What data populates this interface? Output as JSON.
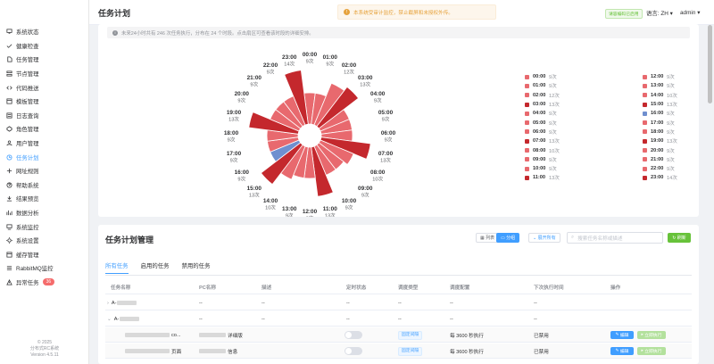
{
  "sidebar": {
    "items": [
      {
        "label": "系统状态",
        "icon": "monitor-icon"
      },
      {
        "label": "健康检查",
        "icon": "check-icon"
      },
      {
        "label": "任务管理",
        "icon": "file-icon"
      },
      {
        "label": "节点管理",
        "icon": "node-icon"
      },
      {
        "label": "代码推送",
        "icon": "code-icon"
      },
      {
        "label": "模板管理",
        "icon": "template-icon"
      },
      {
        "label": "日志查询",
        "icon": "log-icon"
      },
      {
        "label": "角色管理",
        "icon": "role-icon"
      },
      {
        "label": "用户管理",
        "icon": "user-icon"
      },
      {
        "label": "任务计划",
        "icon": "clock-icon",
        "active": true
      },
      {
        "label": "网址规则",
        "icon": "link-icon"
      },
      {
        "label": "帮助系统",
        "icon": "help-icon"
      },
      {
        "label": "结果预览",
        "icon": "download-icon"
      },
      {
        "label": "数据分析",
        "icon": "chart-icon"
      },
      {
        "label": "系统监控",
        "icon": "screen-icon"
      },
      {
        "label": "系统设置",
        "icon": "gear-icon"
      },
      {
        "label": "缓存管理",
        "icon": "cache-icon"
      },
      {
        "label": "RabbitMQ监控",
        "icon": "queue-icon"
      },
      {
        "label": "异常任务",
        "icon": "warning-icon",
        "badge": "36"
      }
    ],
    "footer_line1": "© 2025",
    "footer_line2": "分布式RC系统",
    "footer_line3": "Version 4.5.11"
  },
  "header": {
    "title": "任务计划",
    "warning": "本系统受审计监控，禁止截屏和未授权外传。",
    "tag": "请容编码已启用",
    "lang": "语言: ZH",
    "user": "admin"
  },
  "overview": {
    "info": "未来24小时共有 246 次任务执行，分布在 24 个时段。点击扇区可查看该时段的详细安排。"
  },
  "chart_data": {
    "type": "pie",
    "subtype": "rose",
    "categories": [
      "00:00",
      "01:00",
      "02:00",
      "03:00",
      "04:00",
      "05:00",
      "06:00",
      "07:00",
      "08:00",
      "09:00",
      "10:00",
      "11:00",
      "12:00",
      "13:00",
      "14:00",
      "15:00",
      "16:00",
      "17:00",
      "18:00",
      "19:00",
      "20:00",
      "21:00",
      "22:00",
      "23:00"
    ],
    "values": [
      9,
      9,
      12,
      13,
      9,
      9,
      9,
      13,
      10,
      9,
      9,
      13,
      9,
      9,
      10,
      13,
      9,
      9,
      9,
      13,
      9,
      9,
      9,
      14
    ],
    "unit_suffix": "次",
    "colors": [
      "#e8696e",
      "#e8696e",
      "#e8696e",
      "#c4282d",
      "#e8696e",
      "#e8696e",
      "#e8696e",
      "#c4282d",
      "#e8696e",
      "#e8696e",
      "#e8696e",
      "#c4282d",
      "#e8696e",
      "#e8696e",
      "#e8696e",
      "#c4282d",
      "#6f8fcf",
      "#e8696e",
      "#e8696e",
      "#c4282d",
      "#e8696e",
      "#e8696e",
      "#e8696e",
      "#c4282d"
    ]
  },
  "manage": {
    "title": "任务计划管理",
    "btn_list": "列表",
    "btn_group": "分组",
    "btn_expand": "展开所有",
    "search_placeholder": "搜索任务名称或描述",
    "btn_refresh": "刷新",
    "tabs": [
      "所有任务",
      "启用的任务",
      "禁用的任务"
    ],
    "columns": [
      "任务名称",
      "PC名称",
      "描述",
      "定时状态",
      "调度类型",
      "调度配置",
      "下次执行时间",
      "操作"
    ],
    "groups": [
      {
        "name": "A-",
        "collapsed": true,
        "cells": [
          "--",
          "--",
          "--",
          "--",
          "--",
          "--"
        ]
      },
      {
        "name": "A-",
        "collapsed": false,
        "cells": [
          "--",
          "--",
          "--",
          "--",
          "--",
          "--"
        ]
      }
    ],
    "rows": [
      {
        "name_suffix": "co...",
        "desc": "详细版",
        "type": "固定间隔",
        "config": "每 3600 秒执行",
        "next": "已禁用",
        "edit": "编辑",
        "run": "立即执行"
      },
      {
        "name_suffix": "页面",
        "desc": "信息",
        "type": "固定间隔",
        "config": "每 3600 秒执行",
        "next": "已禁用",
        "edit": "编辑",
        "run": "立即执行"
      }
    ]
  }
}
